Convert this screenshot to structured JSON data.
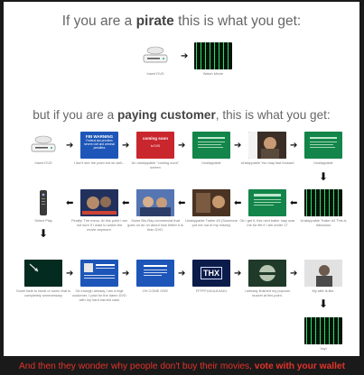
{
  "headings": {
    "pirate_prefix": "If you are a ",
    "pirate_bold": "pirate",
    "pirate_suffix": " this is what you get:",
    "customer_prefix": "but if you are a ",
    "customer_bold": "paying customer",
    "customer_suffix": ", this is what you get:"
  },
  "pirate_steps": {
    "insert": "Insert DVD",
    "watch": "Watch Movie"
  },
  "row1": {
    "insert": "Insert DVD",
    "fbi": "I don't see the point but ok well...",
    "coming_soon": "An unskippable \"coming soon\" screen",
    "unskip1": "Unskippable",
    "fast_forward": "Unskippable You may fast forward",
    "unskip2": "Unskippable"
  },
  "row2": {
    "select_play": "Select Play",
    "finally": "Finally! The menu. At this point I am not sure if I want to watch the movie anymore.",
    "bluray": "Some Blu-Ray commercial that goes on an on about how better it is than DVD.",
    "trailer3": "Unskippable Trailer #3 (Someone put me out of my misery)",
    "rated": "Ok I get it, this next trailer may scar me for life if I am under 17",
    "trailer4": "Unskippable Trailer #4 This is ridiculous"
  },
  "row3": {
    "fade": "Some fade to black or sumn that is completely unnecessary",
    "warning2": "Ok enough already I am a legit customer, I paid for the damn DVD with my hard earned cash",
    "come_on": "OH COME ON!!!",
    "thx": "FFFFFUUUUUUUU",
    "popcorn": "I already finished my popcorn bucket at this point.",
    "dad": "My wife is like.",
    "yay": "Yay!"
  },
  "picture_text": {
    "fbi_title": "FBI WARNING",
    "fbi_body": "Federal law provides severe civil and criminal penalties",
    "coming_soon": "coming soon",
    "to_dvd": "to DVD",
    "thx_logo": "THX"
  },
  "footer": {
    "plain": "And then they wonder why people don't buy their movies, ",
    "bold": "vote with your wallet"
  },
  "colors": {
    "fbi_blue": "#1d56b8",
    "warning_green": "#13854a",
    "coming_soon_red": "#c9262d",
    "matrix_green": "#3cff78",
    "footer_red": "#e2332b"
  }
}
